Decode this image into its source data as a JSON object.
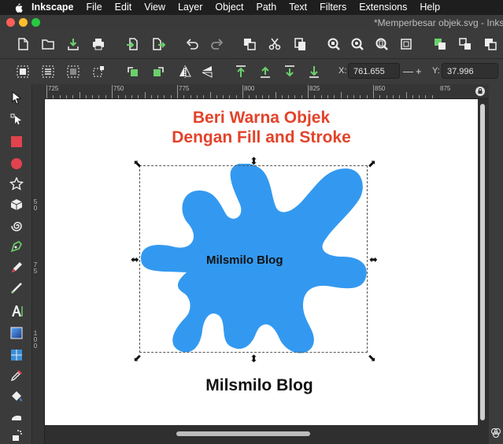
{
  "menubar": {
    "app_name": "Inkscape",
    "items": [
      "File",
      "Edit",
      "View",
      "Layer",
      "Object",
      "Path",
      "Text",
      "Filters",
      "Extensions",
      "Help"
    ]
  },
  "window": {
    "title": "*Memperbesar objek.svg - Inksc"
  },
  "command_bar": {
    "icons": [
      "new-document-icon",
      "open-icon",
      "save-icon",
      "print-icon",
      "import-icon",
      "export-icon",
      "undo-icon",
      "redo-icon",
      "duplicate-icon",
      "cut-icon",
      "copy-icon",
      "paste-icon",
      "zoom-selection-icon",
      "zoom-drawing-icon",
      "zoom-page-icon",
      "zoom-page-width-icon",
      "group-icon",
      "ungroup-icon",
      "fill-stroke-icon"
    ]
  },
  "controls_bar": {
    "x_label": "X:",
    "x_value": "761.655",
    "y_label": "Y:",
    "y_value": "37.996",
    "spin_minus": "—",
    "spin_plus": "+"
  },
  "ruler": {
    "h_labels": [
      "725",
      "750",
      "775",
      "800",
      "825",
      "850",
      "875"
    ],
    "v_labels": [
      "5",
      "0",
      "7",
      "5",
      "1",
      "0",
      "0"
    ]
  },
  "toolbox": {
    "tools": [
      "selector-tool-icon",
      "node-tool-icon",
      "rectangle-tool-icon",
      "ellipse-tool-icon",
      "star-tool-icon",
      "3d-box-tool-icon",
      "spiral-tool-icon",
      "pen-tool-icon",
      "pencil-tool-icon",
      "calligraphy-tool-icon",
      "text-tool-icon",
      "gradient-tool-icon",
      "mesh-tool-icon",
      "dropper-tool-icon",
      "paint-bucket-tool-icon",
      "tweak-tool-icon",
      "spray-tool-icon"
    ]
  },
  "canvas": {
    "heading_line1": "Beri Warna Objek",
    "heading_line2": "Dengan Fill and Stroke",
    "blob_label": "Milsmilo Blog",
    "caption": "Milsmilo Blog",
    "heading_color": "#e2432a",
    "blob_color": "#3399f0"
  }
}
